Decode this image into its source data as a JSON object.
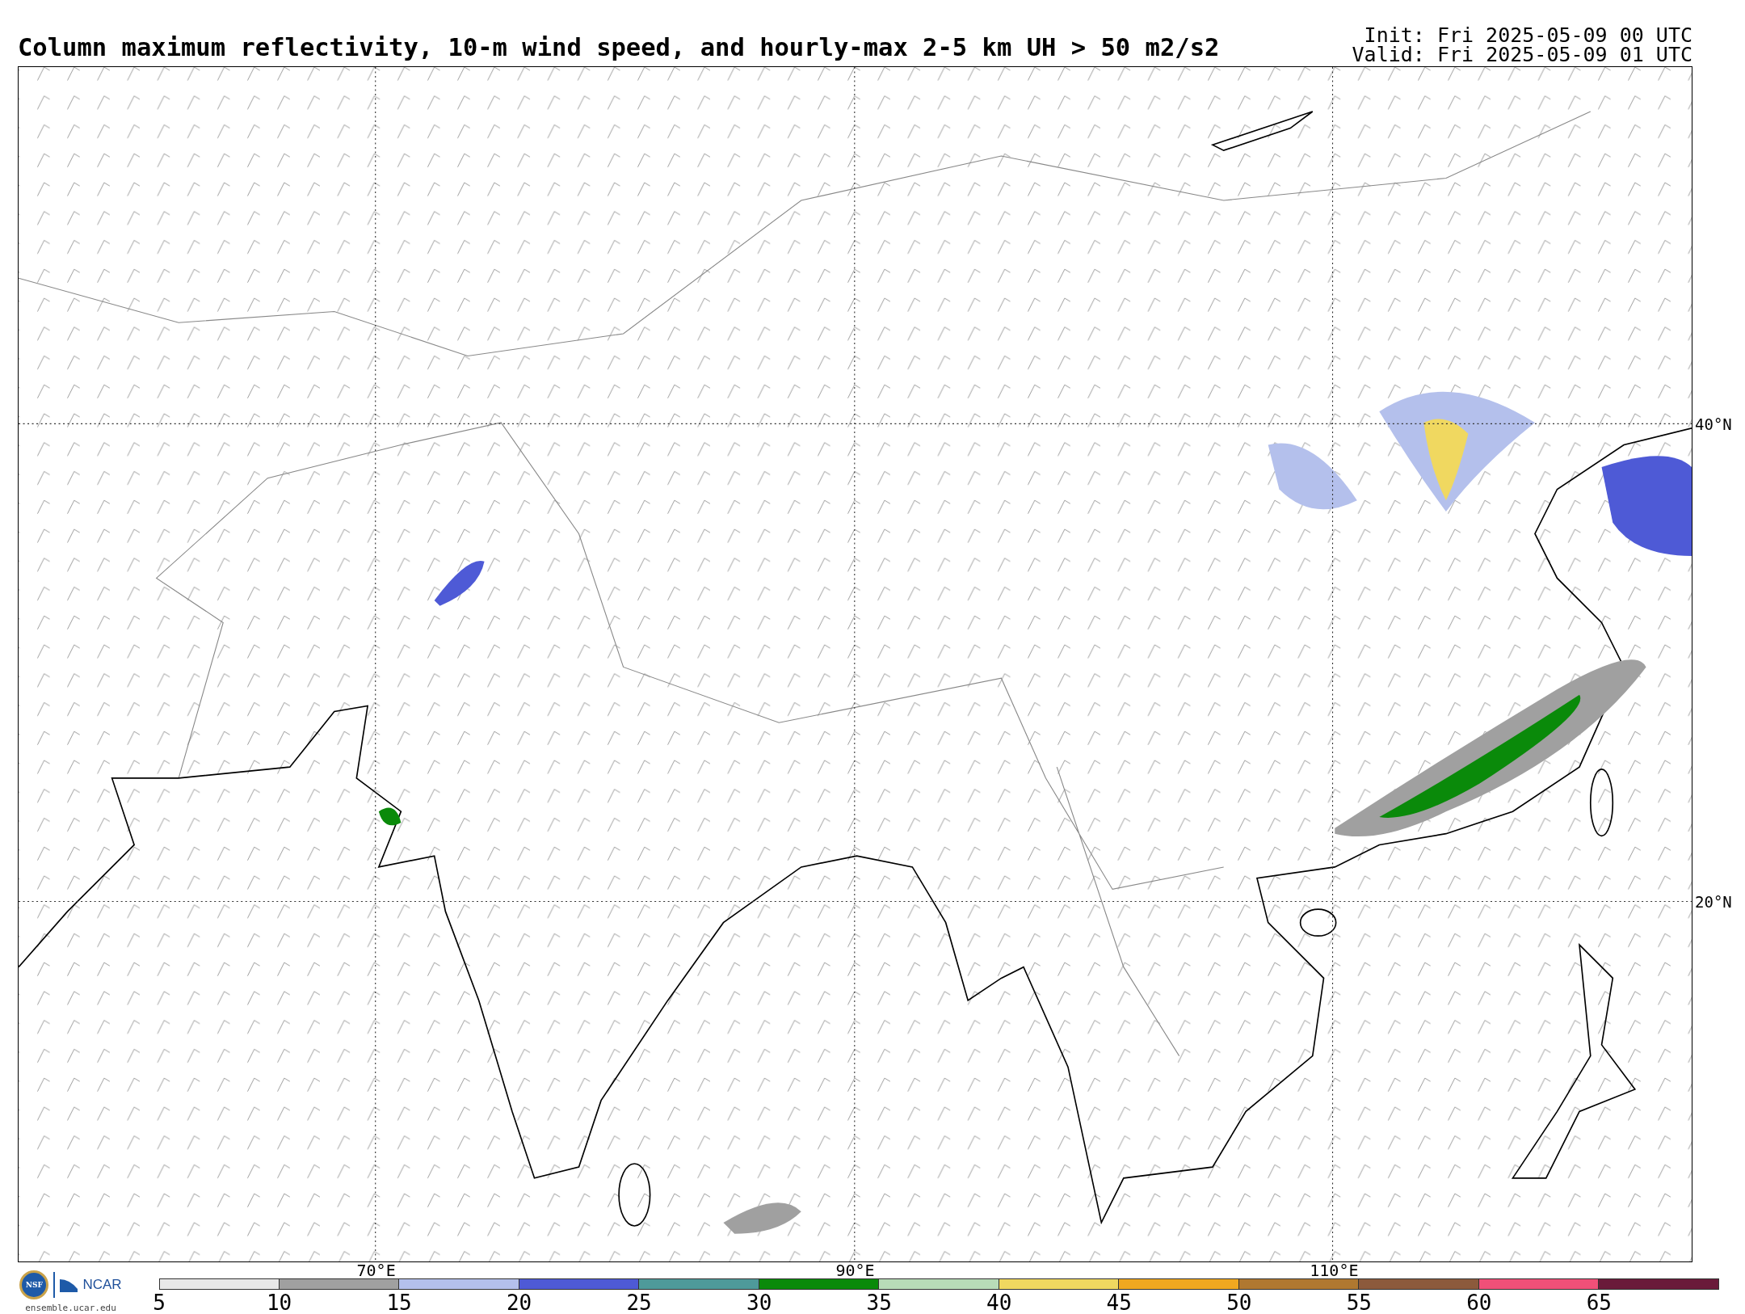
{
  "title": "Column maximum reflectivity, 10-m wind speed, and hourly-max 2-5 km UH > 50 m2/s2",
  "init": "Init: Fri 2025-05-09 00 UTC",
  "valid": "Valid: Fri 2025-05-09 01 UTC",
  "map": {
    "lat_labels": [
      "40°N",
      "20°N"
    ],
    "lon_labels": [
      "70°E",
      "90°E",
      "110°E"
    ]
  },
  "branding": {
    "nsf": "NSF",
    "ncar": "NCAR",
    "url": "ensemble.ucar.edu"
  },
  "colorbar": {
    "bins": [
      {
        "color": "#e8e8e8"
      },
      {
        "color": "#a0a0a0"
      },
      {
        "color": "#b4c0ec"
      },
      {
        "color": "#4e5ad6"
      },
      {
        "color": "#4e9a9a"
      },
      {
        "color": "#0a8a0a"
      },
      {
        "color": "#b8dcb8"
      },
      {
        "color": "#f0d860"
      },
      {
        "color": "#f0a820"
      },
      {
        "color": "#b07830"
      },
      {
        "color": "#8c5a3c"
      },
      {
        "color": "#f05078"
      },
      {
        "color": "#6a1a3a"
      }
    ],
    "ticks": [
      "5",
      "10",
      "15",
      "20",
      "25",
      "30",
      "35",
      "40",
      "45",
      "50",
      "55",
      "60",
      "65"
    ]
  }
}
